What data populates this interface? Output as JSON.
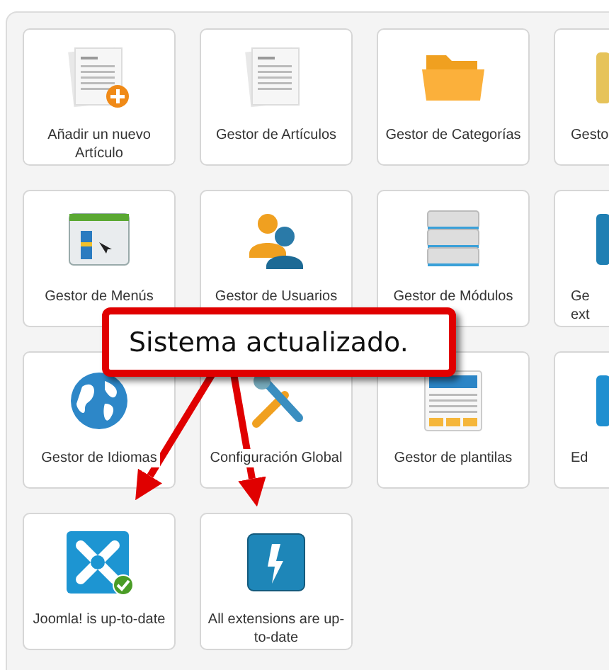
{
  "rows": [
    {
      "tiles": [
        {
          "kind": "full",
          "label": "Añadir un nuevo Artículo"
        },
        {
          "kind": "full",
          "label": "Gestor de Artículos"
        },
        {
          "kind": "full",
          "label": "Gestor de Categorías"
        },
        {
          "kind": "partial",
          "label": "Gesto"
        }
      ]
    },
    {
      "tiles": [
        {
          "kind": "full",
          "label": "Gestor de Menús"
        },
        {
          "kind": "full",
          "label": "Gestor de Usuarios"
        },
        {
          "kind": "full",
          "label": "Gestor de Módulos"
        },
        {
          "kind": "partial",
          "label": "Ge ext"
        }
      ]
    },
    {
      "tiles": [
        {
          "kind": "full",
          "label": "Gestor de Idiomas"
        },
        {
          "kind": "full",
          "label": "Configuración Global"
        },
        {
          "kind": "full",
          "label": "Gestor de plantilas"
        },
        {
          "kind": "partial",
          "label": "Ed"
        }
      ]
    },
    {
      "tiles": [
        {
          "kind": "full",
          "label": "Joomla! is up-to-date"
        },
        {
          "kind": "full",
          "label": "All extensions are up-to-date"
        }
      ]
    }
  ],
  "callout": {
    "text": "Sistema actualizado."
  }
}
